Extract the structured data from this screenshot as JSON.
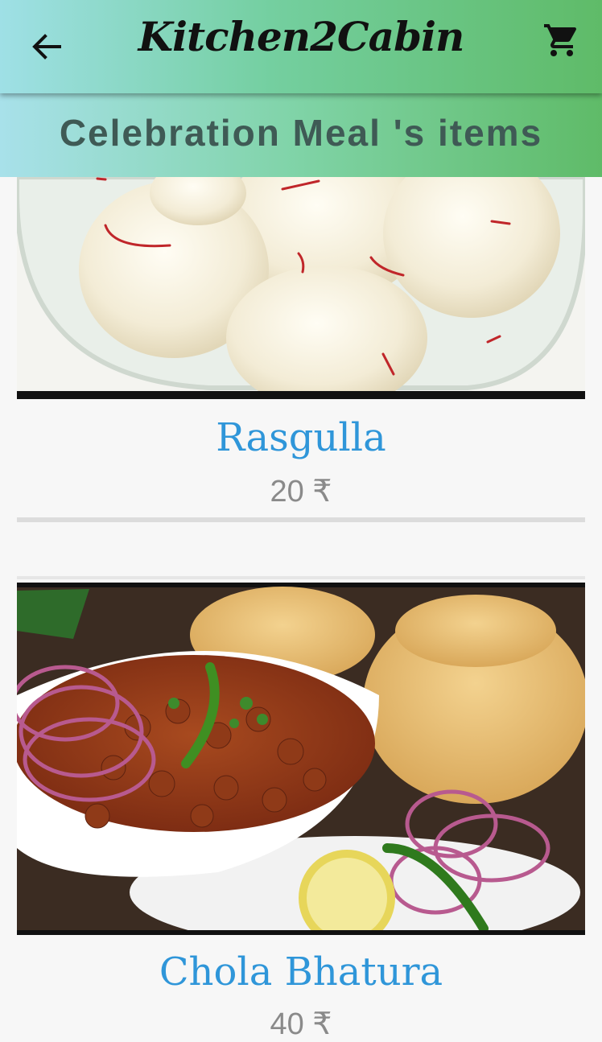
{
  "app": {
    "brand": "Kitchen2Cabin"
  },
  "header": {
    "back_icon": "arrow-left-icon",
    "cart_icon": "shopping-cart-icon",
    "subtitle": "Celebration Meal 's items"
  },
  "items": [
    {
      "name": "Rasgulla",
      "price": "20 ₹",
      "image": "rasgulla-photo"
    },
    {
      "name": "Chola Bhatura",
      "price": "40 ₹",
      "image": "chola-bhatura-photo"
    }
  ],
  "colors": {
    "header_gradient_start": "#9fe0e6",
    "header_gradient_end": "#5fbb68",
    "item_name": "#2f96d9",
    "price": "#8a8a8a"
  }
}
